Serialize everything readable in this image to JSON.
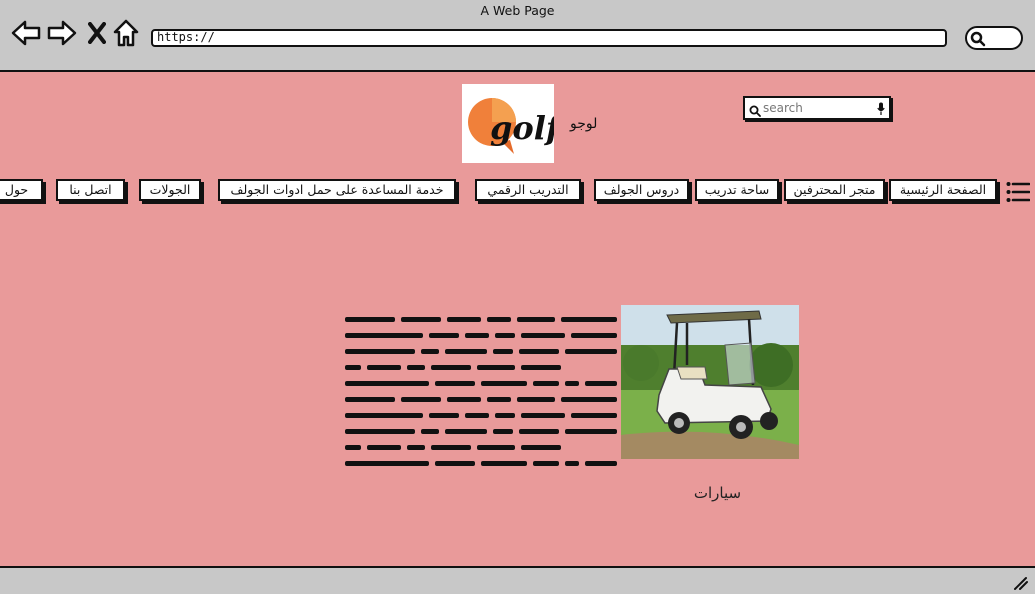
{
  "window": {
    "title": "A Web Page"
  },
  "address_bar": {
    "value": "https://"
  },
  "header": {
    "logo_text": "لوجو",
    "search": {
      "placeholder": "search"
    }
  },
  "nav": {
    "items": [
      {
        "label": "الصفحة الرئيسية"
      },
      {
        "label": "متجر المحترفين"
      },
      {
        "label": "ساحة تدريب"
      },
      {
        "label": "دروس الجولف"
      },
      {
        "label": "التدريب الرقمي"
      },
      {
        "label": "خدمة المساعدة على حمل ادوات الجولف"
      },
      {
        "label": "الجولات"
      },
      {
        "label": "اتصل بنا"
      },
      {
        "label": "حول"
      }
    ]
  },
  "content": {
    "caption": "سيارات"
  },
  "colors": {
    "page_background": "#e99a9a",
    "chrome_background": "#c8c8c8",
    "logo_orange": "#f08030"
  },
  "icons": [
    "back-arrow-icon",
    "forward-arrow-icon",
    "close-icon",
    "home-icon",
    "search-icon",
    "microphone-icon",
    "hamburger-menu-icon",
    "resize-grip-icon"
  ]
}
